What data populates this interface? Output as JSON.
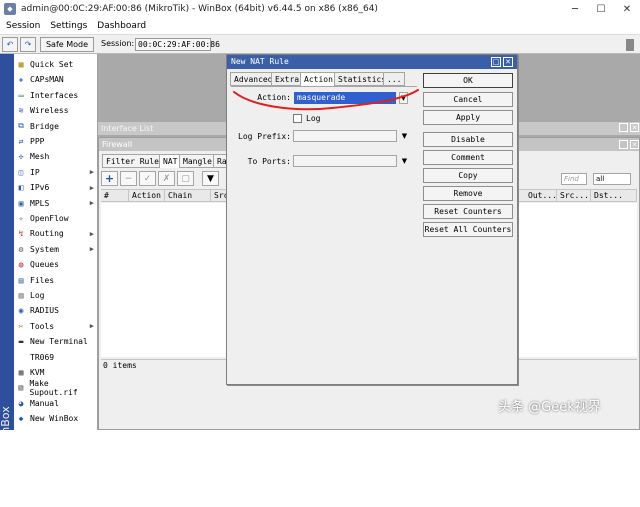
{
  "window": {
    "title": "admin@00:0C:29:AF:00:86 (MikroTik) - WinBox (64bit) v6.44.5 on x86 (x86_64)",
    "controls": [
      "minimize-icon",
      "maximize-icon",
      "close-icon"
    ]
  },
  "menubar": {
    "items": [
      "Session",
      "Settings",
      "Dashboard"
    ]
  },
  "toolbar": {
    "undo_icon": "undo-icon",
    "redo_icon": "redo-icon",
    "safe_mode_label": "Safe Mode",
    "session_label": "Session:",
    "session_value": "00:0C:29:AF:00:86"
  },
  "sidebar": {
    "brand": "RouterOS WinBox",
    "items": [
      {
        "label": "Quick Set",
        "icon": "quick-set-icon",
        "submenu": false
      },
      {
        "label": "CAPsMAN",
        "icon": "capsman-icon",
        "submenu": false
      },
      {
        "label": "Interfaces",
        "icon": "interfaces-icon",
        "submenu": false
      },
      {
        "label": "Wireless",
        "icon": "wireless-icon",
        "submenu": false
      },
      {
        "label": "Bridge",
        "icon": "bridge-icon",
        "submenu": false
      },
      {
        "label": "PPP",
        "icon": "ppp-icon",
        "submenu": false
      },
      {
        "label": "Mesh",
        "icon": "mesh-icon",
        "submenu": false
      },
      {
        "label": "IP",
        "icon": "ip-icon",
        "submenu": true
      },
      {
        "label": "IPv6",
        "icon": "ipv6-icon",
        "submenu": true
      },
      {
        "label": "MPLS",
        "icon": "mpls-icon",
        "submenu": true
      },
      {
        "label": "OpenFlow",
        "icon": "openflow-icon",
        "submenu": false
      },
      {
        "label": "Routing",
        "icon": "routing-icon",
        "submenu": true
      },
      {
        "label": "System",
        "icon": "system-icon",
        "submenu": true
      },
      {
        "label": "Queues",
        "icon": "queues-icon",
        "submenu": false
      },
      {
        "label": "Files",
        "icon": "files-icon",
        "submenu": false
      },
      {
        "label": "Log",
        "icon": "log-icon",
        "submenu": false
      },
      {
        "label": "RADIUS",
        "icon": "radius-icon",
        "submenu": false
      },
      {
        "label": "Tools",
        "icon": "tools-icon",
        "submenu": true
      },
      {
        "label": "New Terminal",
        "icon": "terminal-icon",
        "submenu": false
      },
      {
        "label": "TR069",
        "icon": "",
        "submenu": false
      },
      {
        "label": "KVM",
        "icon": "kvm-icon",
        "submenu": false
      },
      {
        "label": "Make Supout.rif",
        "icon": "supout-icon",
        "submenu": false
      },
      {
        "label": "Manual",
        "icon": "manual-icon",
        "submenu": false
      },
      {
        "label": "New WinBox",
        "icon": "winbox-icon",
        "submenu": false
      }
    ]
  },
  "interface_list": {
    "title": "Interface List"
  },
  "firewall": {
    "title": "Firewall",
    "tabs": [
      "Filter Rules",
      "NAT",
      "Mangle",
      "Ra"
    ],
    "active_tab": "NAT",
    "find_placeholder": "Find",
    "filter_value": "all",
    "columns": [
      "#",
      "Action",
      "Chain",
      "Src",
      "Out...",
      "Src...",
      "Dst..."
    ],
    "status": "0 items"
  },
  "nat_rule": {
    "title": "New NAT Rule",
    "tabs": [
      "Advanced",
      "Extra",
      "Action",
      "Statistics",
      "..."
    ],
    "active_tab": "Action",
    "action_label": "Action:",
    "action_value": "masquerade",
    "log_label": "Log",
    "log_checked": false,
    "log_prefix_label": "Log Prefix:",
    "log_prefix_value": "",
    "to_ports_label": "To Ports:",
    "to_ports_value": "",
    "buttons": [
      "OK",
      "Cancel",
      "Apply",
      "Disable",
      "Comment",
      "Copy",
      "Remove",
      "Reset Counters",
      "Reset All Counters"
    ]
  },
  "annotation": {
    "color": "#e0201c"
  },
  "watermark": "头条 @Geek视界",
  "colors": {
    "accent": "#3a5fa8",
    "selection": "#2f5fd0",
    "brand_strip": "#2e4f9e"
  }
}
